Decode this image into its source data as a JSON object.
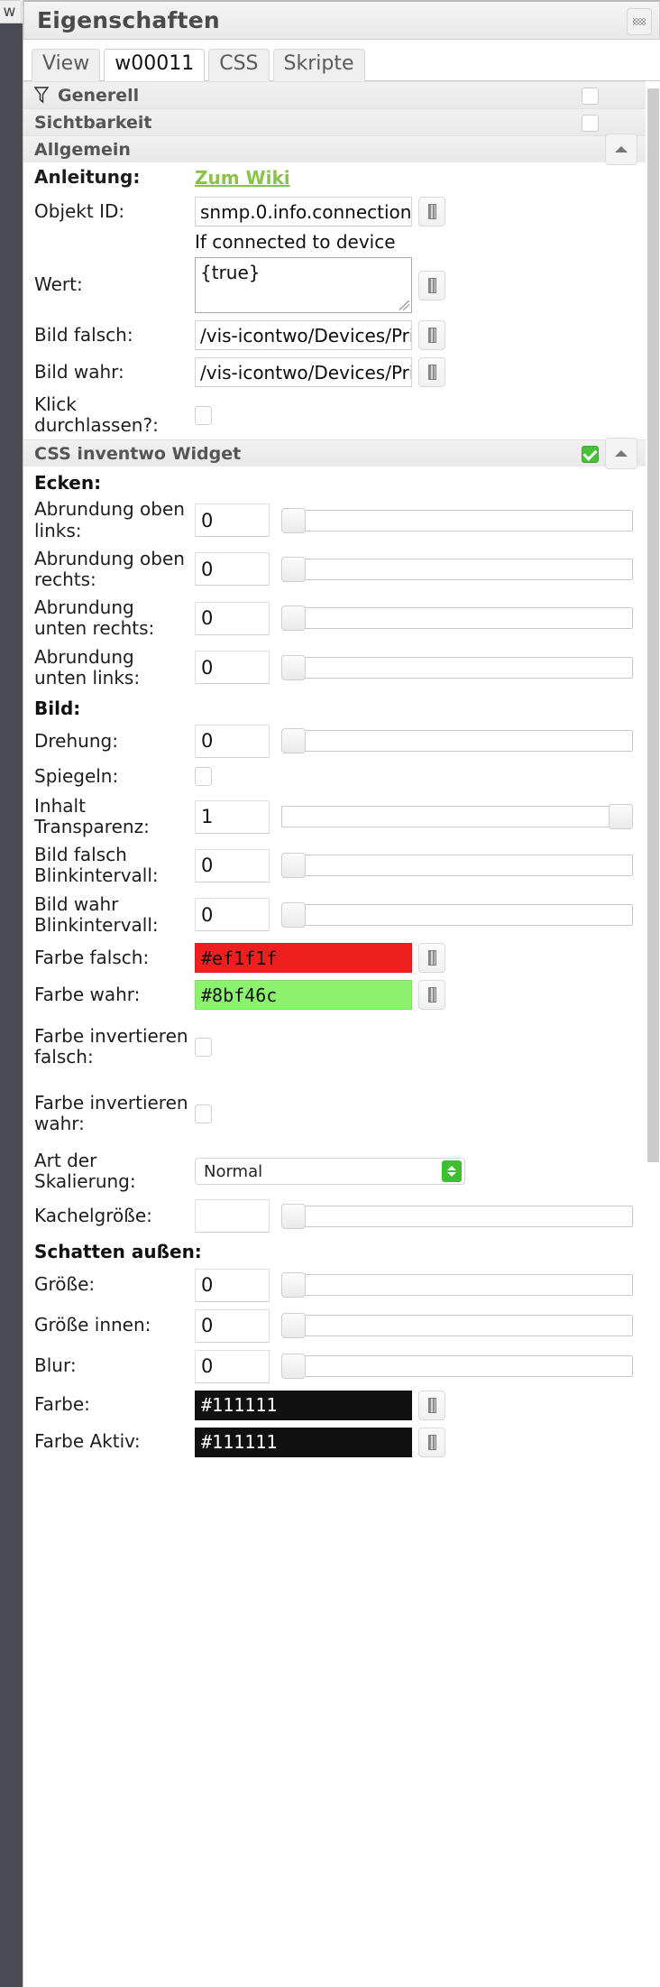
{
  "window": {
    "title": "Eigenschaften",
    "grip_icon": "drag-grip-icon",
    "left_rail_tab": "w"
  },
  "tabs": [
    {
      "label": "View",
      "active": false
    },
    {
      "label": "w00011",
      "active": true
    },
    {
      "label": "CSS",
      "active": false
    },
    {
      "label": "Skripte",
      "active": false
    }
  ],
  "groups": {
    "generell": {
      "label": "Generell",
      "icon": "funnel-icon",
      "checked": false
    },
    "sichtbarkeit": {
      "label": "Sichtbarkeit",
      "checked": false
    },
    "allgemein": {
      "label": "Allgemein",
      "collapse_icon": "caret-up-icon"
    },
    "css_inventwo": {
      "label": "CSS inventwo Widget",
      "checked": true,
      "collapse_icon": "caret-up-icon"
    }
  },
  "allgemein_fields": {
    "anleitung_label": "Anleitung:",
    "anleitung_link": "Zum Wiki",
    "objekt_id_label": "Objekt ID:",
    "objekt_id_value": "snmp.0.info.connection",
    "objekt_id_hint": "If connected to device",
    "wert_label": "Wert:",
    "wert_value": "{true}",
    "bild_falsch_label": "Bild falsch:",
    "bild_falsch_value": "/vis-icontwo/Devices/Prin",
    "bild_wahr_label": "Bild wahr:",
    "bild_wahr_value": "/vis-icontwo/Devices/Prin",
    "klick_label": "Klick durchlassen?:",
    "klick_checked": false
  },
  "css_sections": {
    "ecken_label": "Ecken:",
    "bild_label": "Bild:",
    "schatten_label": "Schatten außen:"
  },
  "css_rows": [
    {
      "label": "Abrundung oben links:",
      "value": "0",
      "type": "slider",
      "knob": "left"
    },
    {
      "label": "Abrundung oben rechts:",
      "value": "0",
      "type": "slider",
      "knob": "left"
    },
    {
      "label": "Abrundung unten rechts:",
      "value": "0",
      "type": "slider",
      "knob": "left"
    },
    {
      "label": "Abrundung unten links:",
      "value": "0",
      "type": "slider",
      "knob": "left"
    },
    {
      "label": "Drehung:",
      "value": "0",
      "type": "slider",
      "knob": "left"
    },
    {
      "label": "Spiegeln:",
      "value": "",
      "type": "checkbox",
      "checked": false
    },
    {
      "label": "Inhalt Transparenz:",
      "value": "1",
      "type": "slider",
      "knob": "right"
    },
    {
      "label": "Bild falsch Blinkintervall:",
      "value": "0",
      "type": "slider",
      "knob": "left"
    },
    {
      "label": "Bild wahr Blinkintervall:",
      "value": "0",
      "type": "slider",
      "knob": "left"
    },
    {
      "label": "Farbe falsch:",
      "value": "#ef1f1f",
      "type": "color",
      "bg": "#ef1f1f",
      "fg": "light"
    },
    {
      "label": "Farbe wahr:",
      "value": "#8bf46c",
      "type": "color",
      "bg": "#8bf46c",
      "fg": "light"
    },
    {
      "label": "Farbe invertieren falsch:",
      "value": "",
      "type": "checkbox",
      "checked": false
    },
    {
      "label": "Farbe invertieren wahr:",
      "value": "",
      "type": "checkbox",
      "checked": false
    },
    {
      "label": "Art der Skalierung:",
      "value": "Normal",
      "type": "select"
    },
    {
      "label": "Kachelgröße:",
      "value": "",
      "type": "slider",
      "knob": "left"
    },
    {
      "label": "Größe:",
      "value": "0",
      "type": "slider",
      "knob": "left"
    },
    {
      "label": "Größe innen:",
      "value": "0",
      "type": "slider",
      "knob": "left"
    },
    {
      "label": "Blur:",
      "value": "0",
      "type": "slider",
      "knob": "left"
    },
    {
      "label": "Farbe:",
      "value": "#111111",
      "type": "color",
      "bg": "#111111",
      "fg": "dark"
    },
    {
      "label": "Farbe Aktiv:",
      "value": "#111111",
      "type": "color",
      "bg": "#111111",
      "fg": "dark"
    }
  ],
  "colors": {
    "accent_green": "#8bc34a",
    "false_color": "#ef1f1f",
    "true_color": "#8bf46c",
    "shadow_color": "#111111",
    "rail": "#4a4a52"
  }
}
